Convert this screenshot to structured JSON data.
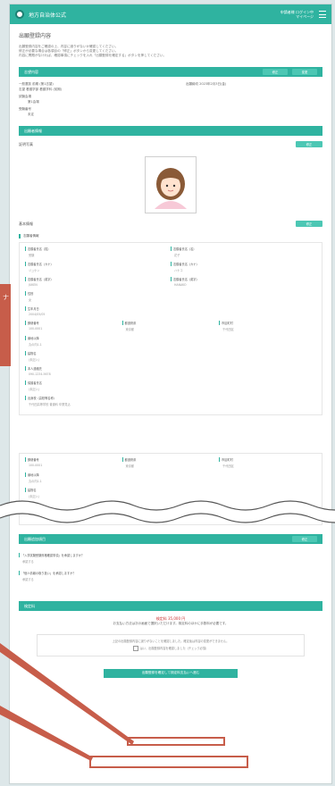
{
  "header": {
    "logo_text": "地方自治体公式",
    "user_line1": "申請者様 ログイン中",
    "user_line2": "マイページ"
  },
  "page": {
    "title": "出願登録内容",
    "intro_lines": [
      "出願登録内容をご確認の上、内容に誤りがないか確認してください。",
      "修正が必要な場合は各項目の「修正」ボタンから変更してください。",
      "内容に問題がなければ、確認事項にチェックを入れ「出願登録を確定する」ボタンを押してください。"
    ]
  },
  "sections": {
    "apply": {
      "title": "志望内容",
      "btn_edit": "修正",
      "btn_change": "変更",
      "rows": [
        "一般選抜 前期 (第1志望)",
        "志望 看護学部 看護学科 (前期)",
        "試験会場",
        "第1会場",
        "受験番号",
        "未定"
      ],
      "deadline": "出願締切 2023年2月3日(金)"
    },
    "applicant": {
      "title": "出願者情報",
      "btn": "修正",
      "photo_label": "証明写真",
      "basic_label": "基本情報",
      "basic_btn": "修正",
      "group_label": "志願者情報",
      "fields": [
        {
          "label": "志願者氏名（姓）",
          "value": "受験"
        },
        {
          "label": "志願者氏名（名）",
          "value": "花子"
        },
        {
          "label": "志願者氏名（カナ）",
          "value": "ジュケン"
        },
        {
          "label": "志願者氏名（カナ）",
          "value": "ハナコ"
        },
        {
          "label": "志願者氏名（英字）",
          "value": "JUKEN"
        },
        {
          "label": "志願者氏名（英字）",
          "value": "HANAKO"
        }
      ],
      "single_fields": [
        {
          "label": "性別",
          "value": "女"
        },
        {
          "label": "生年月日",
          "value": "2004/05/05"
        }
      ],
      "address_row": [
        {
          "label": "郵便番号",
          "value": "100-0001"
        },
        {
          "label": "都道府県",
          "value": "東京都"
        },
        {
          "label": "市区町村",
          "value": "千代田区"
        }
      ],
      "more_fields": [
        {
          "label": "番地以降",
          "value": "丸の内1-1"
        },
        {
          "label": "建物名",
          "value": "(未記入)"
        },
        {
          "label": "本人連絡先",
          "value": "090-1234-5678"
        },
        {
          "label": "保護者氏名",
          "value": "(未記入)"
        },
        {
          "label": "出身校（高校等名称）",
          "value": "千代田高等学校 普通科 卒業見込"
        }
      ],
      "address_row2": [
        {
          "label": "郵便番号",
          "value": "100-0001"
        },
        {
          "label": "都道府県",
          "value": "東京都"
        },
        {
          "label": "市区町村",
          "value": "千代田区"
        }
      ],
      "more_fields2": [
        {
          "label": "番地以降",
          "value": "丸の内1-1"
        },
        {
          "label": "建物名",
          "value": "(未記入)"
        },
        {
          "label": "緊急連絡先",
          "value": "090-1234-5678"
        }
      ]
    },
    "questions": {
      "title": "出願追加項目",
      "btn": "修正",
      "items": [
        {
          "q": "「入学試験受験資格確認事項」を承認しますか？",
          "a": "承認する"
        },
        {
          "q": "「個人情報の取り扱い」を承認しますか？",
          "a": "承認する"
        }
      ]
    },
    "fee": {
      "title": "検定料",
      "amount": "検定料 35,000 円",
      "note": "お支払い方法は次の画面で選択いただけます。検定料のほかに手数料が必要です。"
    }
  },
  "confirm": {
    "text": "上記の出願登録内容に誤りがないことを確認しました。確定後は内容の変更ができません。",
    "checkbox_label": "はい、出願登録内容を確認しました（チェック必須）",
    "submit_label": "出願登録を確定して検定料支払いへ進む"
  },
  "callout_text": "ナ"
}
